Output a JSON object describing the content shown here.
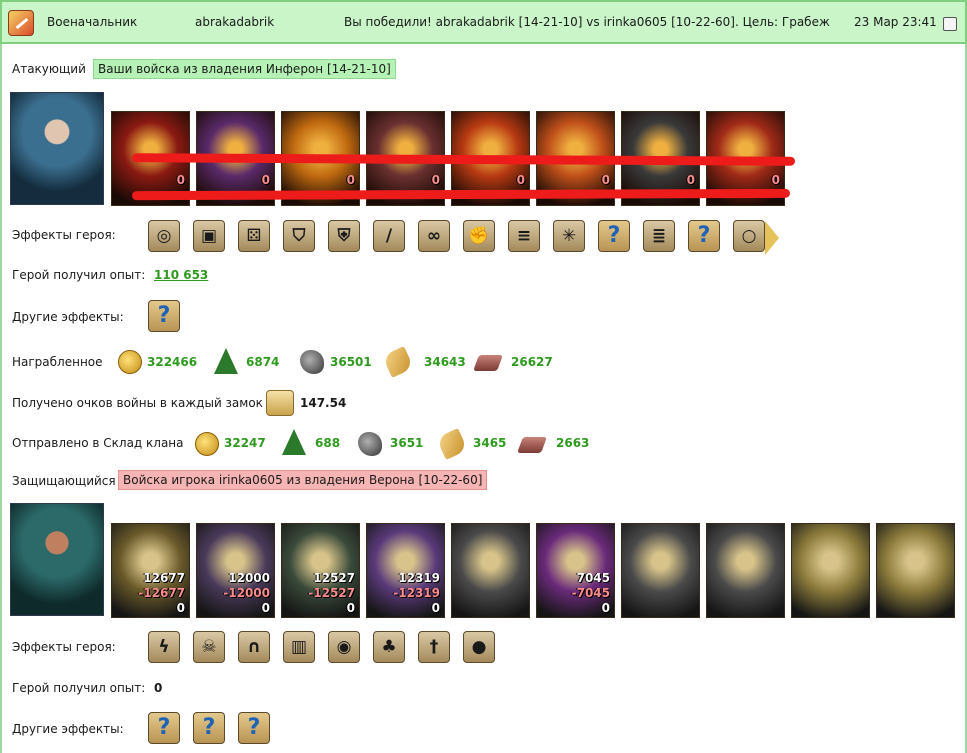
{
  "header": {
    "rank": "Военачальник",
    "player": "abrakadabrik",
    "message": "Вы победили! abrakadabrik [14-21-10] vs irinka0605 [10-22-60]. Цель: Грабеж",
    "datetime": "23 Мар 23:41"
  },
  "attacker": {
    "label": "Атакующий",
    "banner": "Ваши войска из владения Инферон [14-21-10]",
    "units": [
      {
        "name": "unit-1",
        "count": "0",
        "color": "#8a1a12"
      },
      {
        "name": "unit-2",
        "count": "0",
        "color": "#5a2a6a"
      },
      {
        "name": "unit-3",
        "count": "0",
        "color": "#c06a10"
      },
      {
        "name": "unit-4",
        "count": "0",
        "color": "#6a3030"
      },
      {
        "name": "unit-5",
        "count": "0",
        "color": "#b83a12"
      },
      {
        "name": "unit-6",
        "count": "0",
        "color": "#c0501a"
      },
      {
        "name": "unit-7",
        "count": "0",
        "color": "#3a3a3a"
      },
      {
        "name": "unit-8",
        "count": "0",
        "color": "#a02a18"
      }
    ],
    "effects_label": "Эффекты героя:",
    "effects": [
      "coins-icon",
      "chest-icon",
      "dice-icon",
      "shield-icon",
      "shield-hand-icon",
      "sword-icon",
      "handshake-icon",
      "fist-icon",
      "barrel-icon",
      "web-icon",
      "question-icon",
      "barrel2-icon",
      "question-icon",
      "ring-icon"
    ],
    "exp_label": "Герой получил опыт:",
    "exp_value": "110 653",
    "other_effects_label": "Другие эффекты:",
    "loot_label": "Награбленное",
    "loot": {
      "gold": "322466",
      "wood": "6874",
      "ore": "36501",
      "grain": "34643",
      "stone": "26627"
    },
    "war_points_label": "Получено очков войны в каждый замок",
    "war_points": "147.54",
    "clan_label": "Отправлено в Склад клана",
    "clan": {
      "gold": "32247",
      "wood": "688",
      "ore": "3651",
      "grain": "3465",
      "stone": "2663"
    }
  },
  "defender": {
    "label": "Защищающийся",
    "banner": "Войска игрока irinka0605 из владения Верона [10-22-60]",
    "units": [
      {
        "name": "unit-1",
        "c1": "12677",
        "c2": "-12677",
        "c3": "0",
        "color": "#6a5a2a"
      },
      {
        "name": "unit-2",
        "c1": "12000",
        "c2": "-12000",
        "c3": "0",
        "color": "#4a3a5a"
      },
      {
        "name": "unit-3",
        "c1": "12527",
        "c2": "-12527",
        "c3": "0",
        "color": "#3a4a3a"
      },
      {
        "name": "unit-4",
        "c1": "12319",
        "c2": "-12319",
        "c3": "0",
        "color": "#5a3a7a"
      },
      {
        "name": "unit-5",
        "c1": "",
        "c2": "",
        "c3": "",
        "color": "#4a4a4a"
      },
      {
        "name": "unit-6",
        "c1": "7045",
        "c2": "-7045",
        "c3": "0",
        "color": "#6a2a7a"
      },
      {
        "name": "unit-7",
        "c1": "",
        "c2": "",
        "c3": "",
        "color": "#4a4a4a"
      },
      {
        "name": "unit-8",
        "c1": "",
        "c2": "",
        "c3": "",
        "color": "#4a4a4a"
      },
      {
        "name": "unit-9",
        "c1": "",
        "c2": "",
        "c3": "",
        "color": "#8a7a3a"
      },
      {
        "name": "unit-10",
        "c1": "",
        "c2": "",
        "c3": "",
        "color": "#8a7a3a"
      }
    ],
    "effects_label": "Эффекты героя:",
    "effects": [
      "fire-lightning-icon",
      "skull-icon",
      "hood-icon",
      "armor-icon",
      "amulet-icon",
      "clover-icon",
      "dagger-icon",
      "round-shield-icon"
    ],
    "exp_label": "Герой получил опыт:",
    "exp_value": "0",
    "other_effects_label": "Другие эффекты:"
  }
}
